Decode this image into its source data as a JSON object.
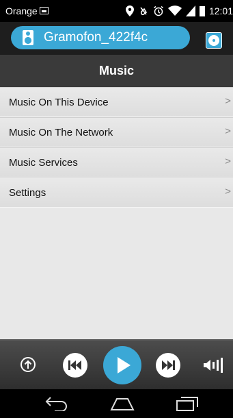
{
  "status_bar": {
    "carrier": "Orange",
    "time": "12:01"
  },
  "device_header": {
    "device_name": "Gramofon_422f4c",
    "device_icon": "speaker-icon",
    "disc_icon": "disc-icon"
  },
  "title": "Music",
  "menu": {
    "items": [
      {
        "label": "Music On This Device",
        "chevron": ">"
      },
      {
        "label": "Music On The Network",
        "chevron": ">"
      },
      {
        "label": "Music Services",
        "chevron": ">"
      },
      {
        "label": "Settings",
        "chevron": ">"
      }
    ]
  },
  "player": {
    "controls": [
      "up-icon",
      "previous-icon",
      "play-icon",
      "next-icon",
      "volume-icon"
    ]
  },
  "nav": {
    "buttons": [
      "back-icon",
      "home-icon",
      "recents-icon"
    ]
  },
  "colors": {
    "accent": "#3ba8d6",
    "header_bg": "#3a3a3a",
    "list_bg": "#e8e8e8"
  }
}
